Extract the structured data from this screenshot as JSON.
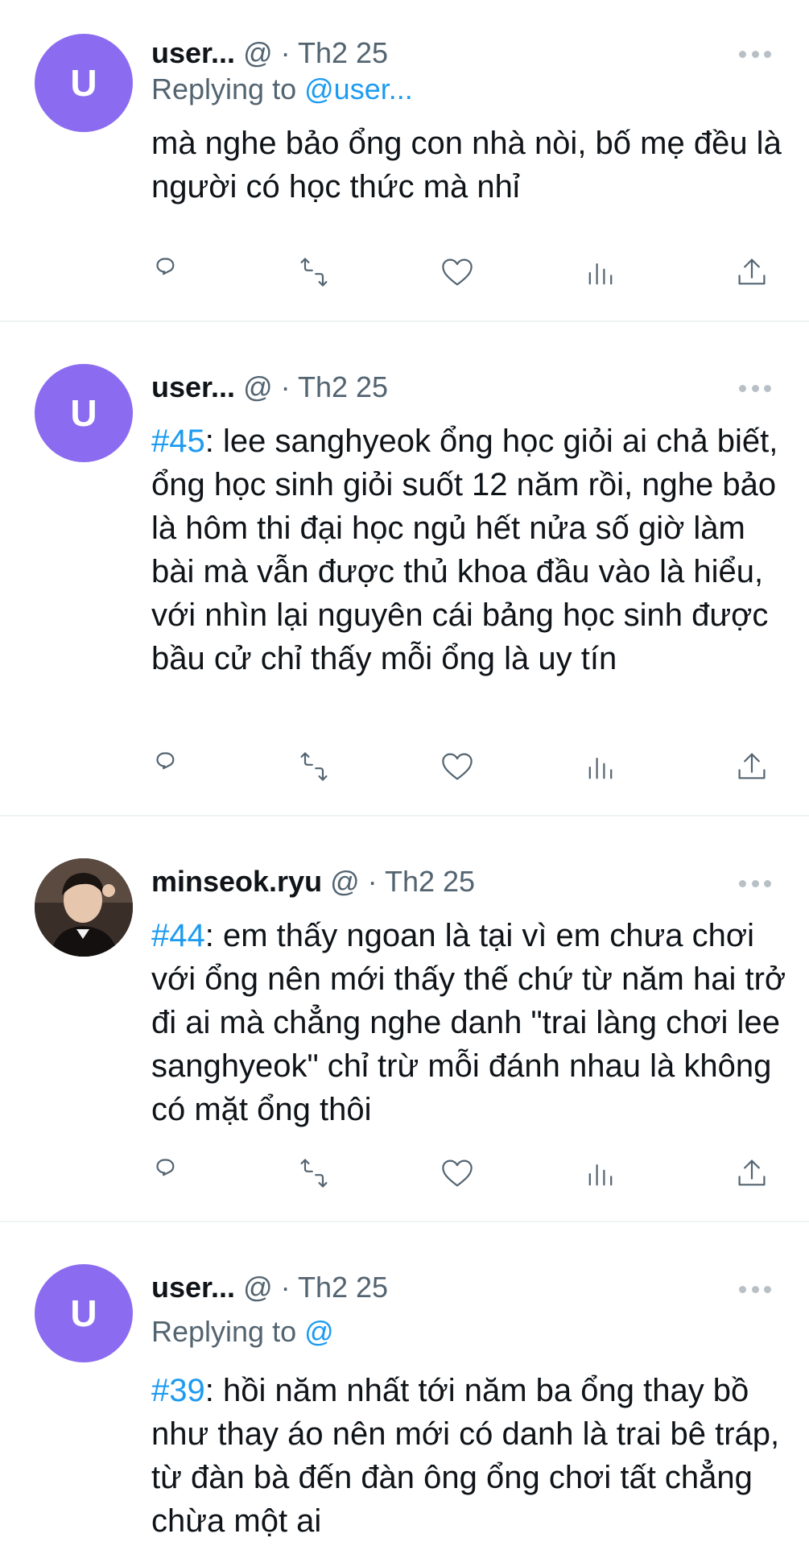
{
  "tweets": [
    {
      "author": "user...",
      "meta": "@ · Th2 25",
      "avatar_letter": "U",
      "replying_prefix": "Replying to",
      "replying_handle": "@user...",
      "tag": "",
      "body": "mà nghe bảo ổng con nhà nòi, bố mẹ đều là người có học thức mà nhỉ"
    },
    {
      "author": "user...",
      "meta": "@ · Th2 25",
      "avatar_letter": "U",
      "tag": "#45",
      "body": ": lee sanghyeok ổng học giỏi ai chả biết, ổng học sinh giỏi suốt 12 năm rồi, nghe bảo là hôm thi đại học ngủ hết nửa số giờ làm bài mà vẫn được thủ khoa đầu vào là hiểu, với nhìn lại nguyên cái bảng học sinh được bầu cử chỉ thấy mỗi ổng là uy tín"
    },
    {
      "author": "minseok.ryu",
      "meta": "@ · Th2 25",
      "tag": "#44",
      "body": ": em thấy ngoan là tại vì em chưa chơi với ổng nên mới thấy thế chứ từ năm hai trở đi ai mà chẳng nghe danh \"trai làng chơi lee sanghyeok\" chỉ trừ mỗi đánh nhau là không có mặt ổng thôi"
    },
    {
      "author": "user...",
      "meta": "@ · Th2 25",
      "avatar_letter": "U",
      "replying_prefix": "Replying to",
      "replying_handle": "@",
      "tag": "#39",
      "body": ": hồi năm nhất tới năm ba ổng thay bồ như thay áo nên mới có danh là trai bê tráp, từ đàn bà đến đàn ông ổng chơi tất chẳng chừa một ai"
    }
  ],
  "icons": [
    "reply-icon",
    "retweet-icon",
    "like-icon",
    "views-icon",
    "share-icon",
    "more-icon"
  ],
  "colors": {
    "accent": "#1d9bf0",
    "avatar": "#8b6cf0",
    "secondary_text": "#536471"
  }
}
